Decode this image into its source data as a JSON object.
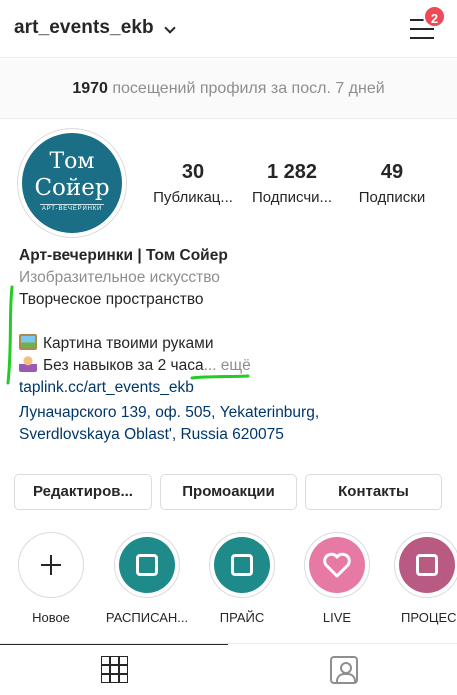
{
  "header": {
    "username": "art_events_ekb",
    "notification_count": "2"
  },
  "visits": {
    "count": "1970",
    "text": "посещений профиля за посл. 7 дней"
  },
  "avatar": {
    "line1": "Том",
    "line2": "Сойер",
    "line3": "АРТ-ВЕЧЕРИНКИ",
    "color": "#1a6e85"
  },
  "stats": [
    {
      "value": "30",
      "label": "Публикац..."
    },
    {
      "value": "1 282",
      "label": "Подписчи..."
    },
    {
      "value": "49",
      "label": "Подписки"
    }
  ],
  "bio": {
    "name": "Арт-вечеринки | Том Сойер",
    "category": "Изобразительное искусство",
    "line1": "Творческое пространство",
    "line2": "Картина твоими руками",
    "line3": "Без навыков за 2 часа",
    "more": "... ещё",
    "link": "taplink.cc/art_events_ekb",
    "address_line1": "Луначарского 139, оф. 505, Yekaterinburg,",
    "address_line2": "Sverdlovskaya Oblast', Russia 620075",
    "link_color": "#00376b"
  },
  "buttons": {
    "edit": "Редактиров...",
    "promo": "Промоакции",
    "contacts": "Контакты"
  },
  "highlights": [
    {
      "label": "Новое",
      "icon": "plus-icon"
    },
    {
      "label": "РАСПИСАН...",
      "icon": "calendar-icon",
      "color": "#1f8a8a"
    },
    {
      "label": "ПРАЙС",
      "icon": "notepad-icon",
      "color": "#1f8a8a"
    },
    {
      "label": "LIVE",
      "icon": "heart-icon",
      "color": "#e77aa5"
    },
    {
      "label": "ПРОЦЕС",
      "icon": "paint-roller-icon",
      "color": "#b85a82"
    }
  ],
  "annotation_color": "#22cc22"
}
